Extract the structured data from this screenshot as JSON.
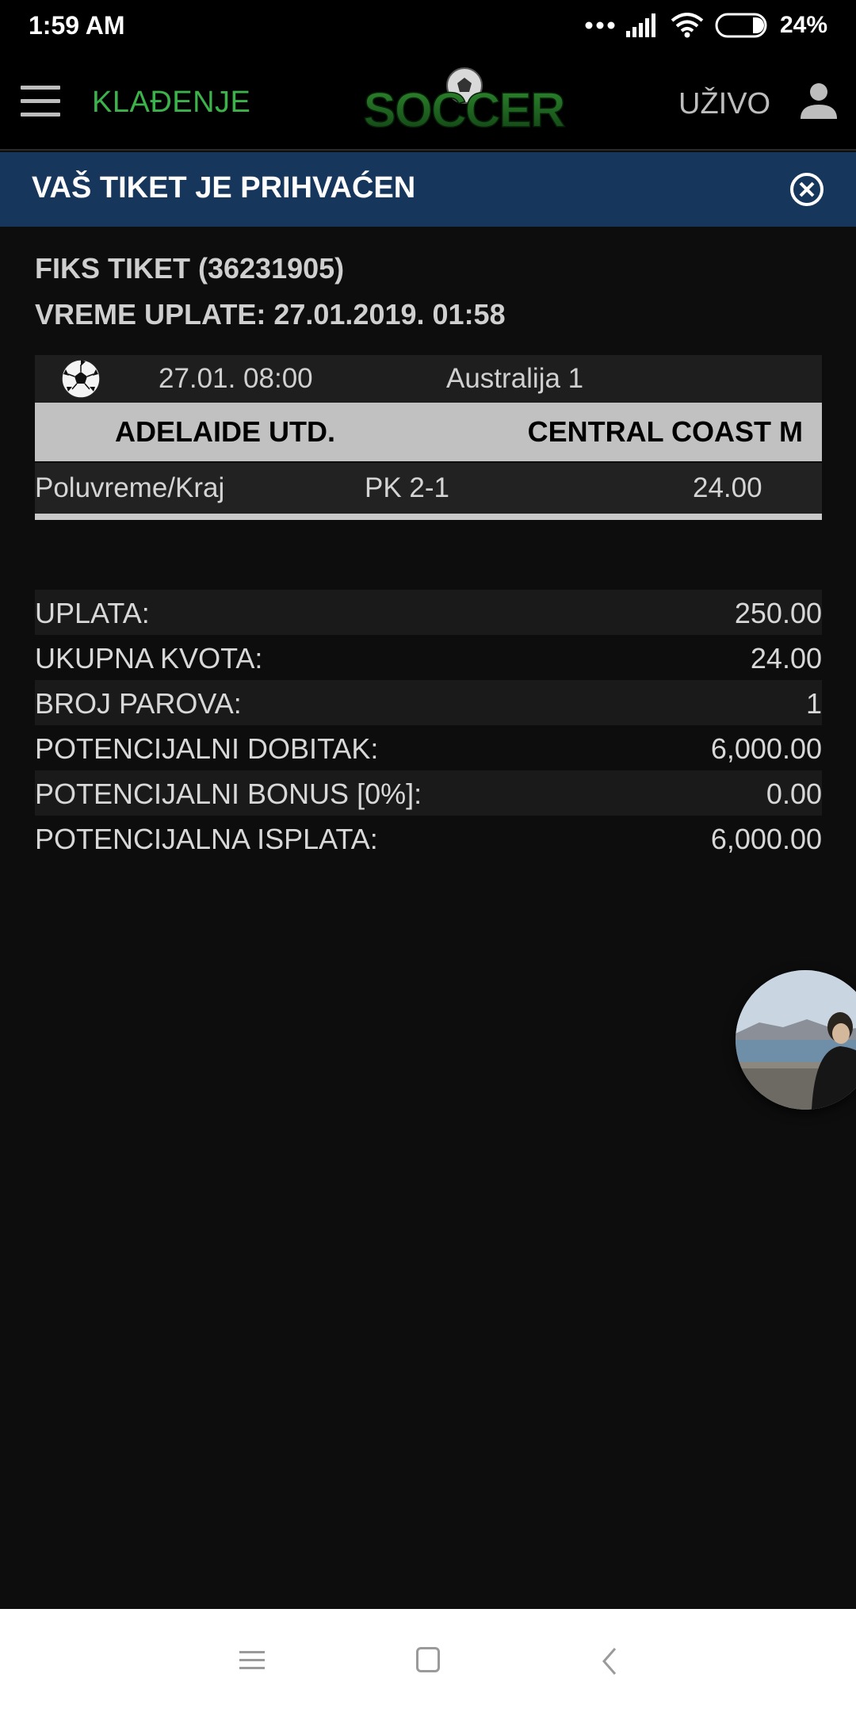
{
  "status_bar": {
    "time": "1:59 AM",
    "battery_percent": "24%",
    "icons": [
      "dots-icon",
      "signal-icon",
      "wifi-icon",
      "battery-icon"
    ]
  },
  "app_bar": {
    "betting_label": "KLAĐENJE",
    "logo_text": "SOCCER",
    "live_label": "UŽIVO",
    "accent_color": "#3bb24a"
  },
  "banner": {
    "title": "VAŠ TIKET JE PRIHVAĆEN",
    "background_color": "#17365c"
  },
  "ticket": {
    "id_line": "FIKS TIKET (36231905)",
    "time_line": "VREME UPLATE: 27.01.2019. 01:58"
  },
  "match": {
    "date": "27.01. 08:00",
    "league": "Australija 1",
    "home_team": "ADELAIDE UTD.",
    "away_team": "CENTRAL COAST M",
    "market": "Poluvreme/Kraj",
    "pick": "PK 2-1",
    "odd": "24.00"
  },
  "summary": [
    {
      "label": "UPLATA:",
      "value": "250.00"
    },
    {
      "label": "UKUPNA KVOTA:",
      "value": "24.00"
    },
    {
      "label": "BROJ PAROVA:",
      "value": "1"
    },
    {
      "label": "POTENCIJALNI DOBITAK:",
      "value": "6,000.00"
    },
    {
      "label": "POTENCIJALNI BONUS [0%]:",
      "value": "0.00"
    },
    {
      "label": "POTENCIJALNA ISPLATA:",
      "value": "6,000.00"
    }
  ]
}
